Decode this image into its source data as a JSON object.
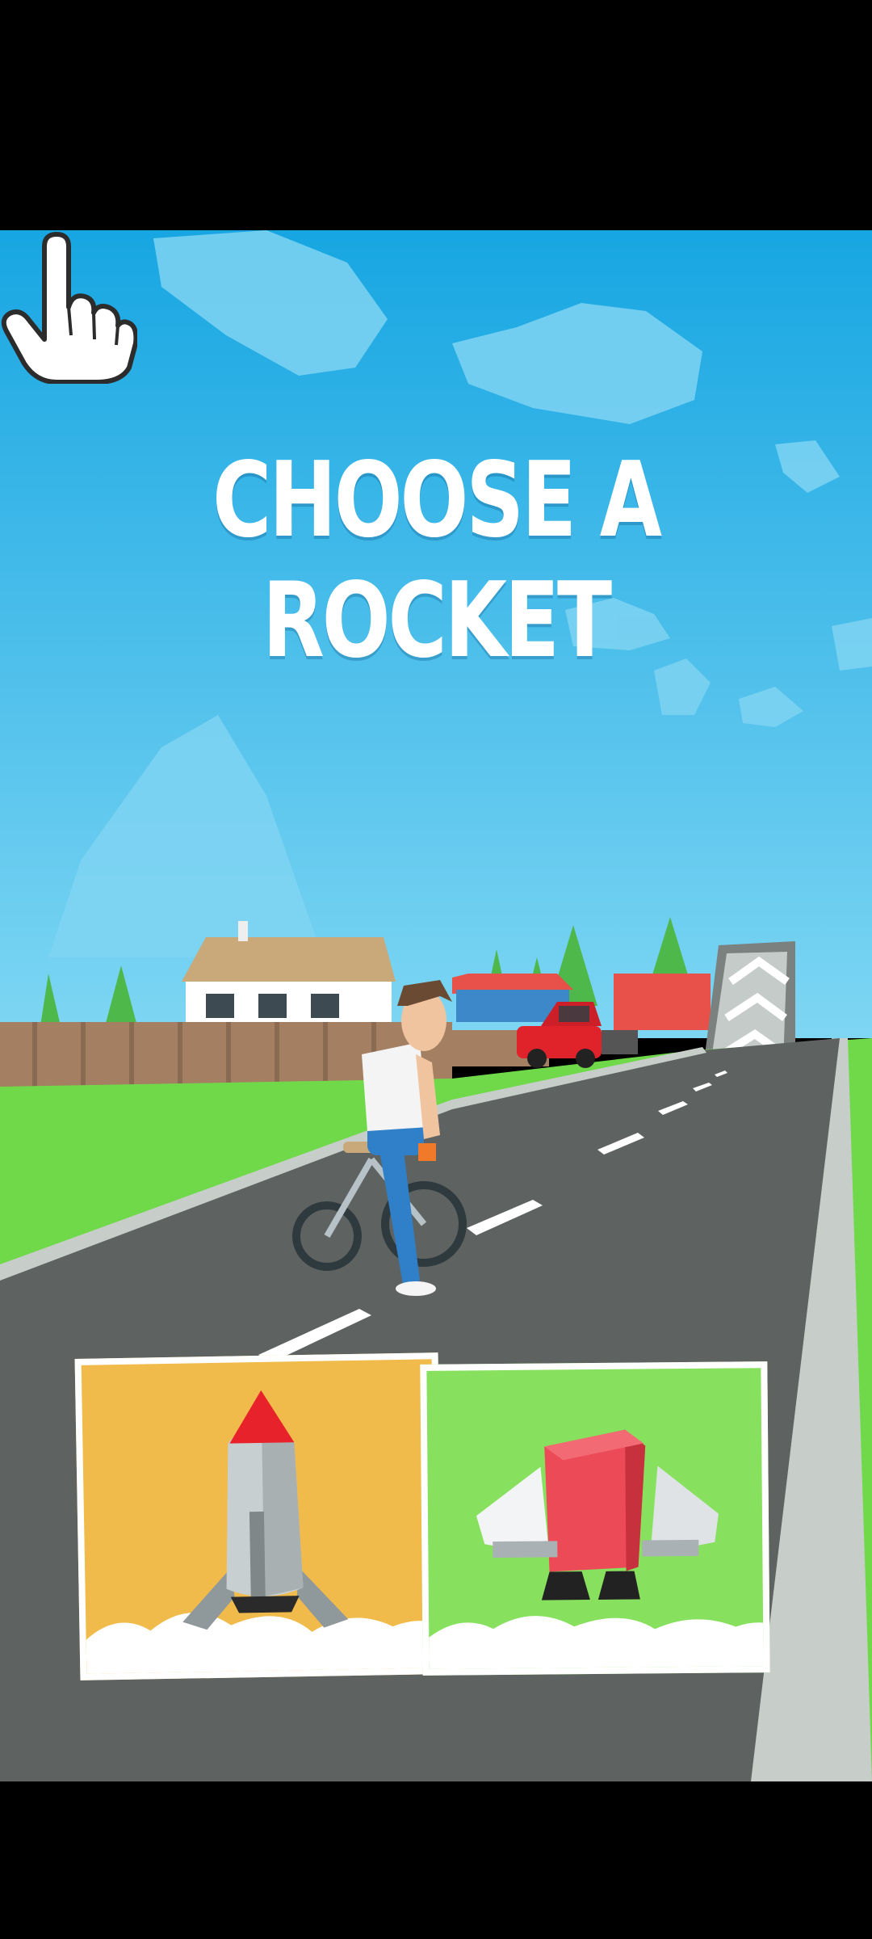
{
  "game": {
    "title": "CHOOSE A ROCKET",
    "choices": [
      {
        "id": "classic-rocket",
        "icon": "classic-rocket-icon",
        "color": "#f1bb4b"
      },
      {
        "id": "jetpack-rocket",
        "icon": "jetpack-icon",
        "color": "#88e15e"
      }
    ],
    "pointer": "tap-hand-icon"
  },
  "colors": {
    "sky_top": "#1aa8e2",
    "sky_bottom": "#7fd6f2",
    "grass": "#6fd94a",
    "road": "#5e6361",
    "title_text": "#ffffff"
  }
}
